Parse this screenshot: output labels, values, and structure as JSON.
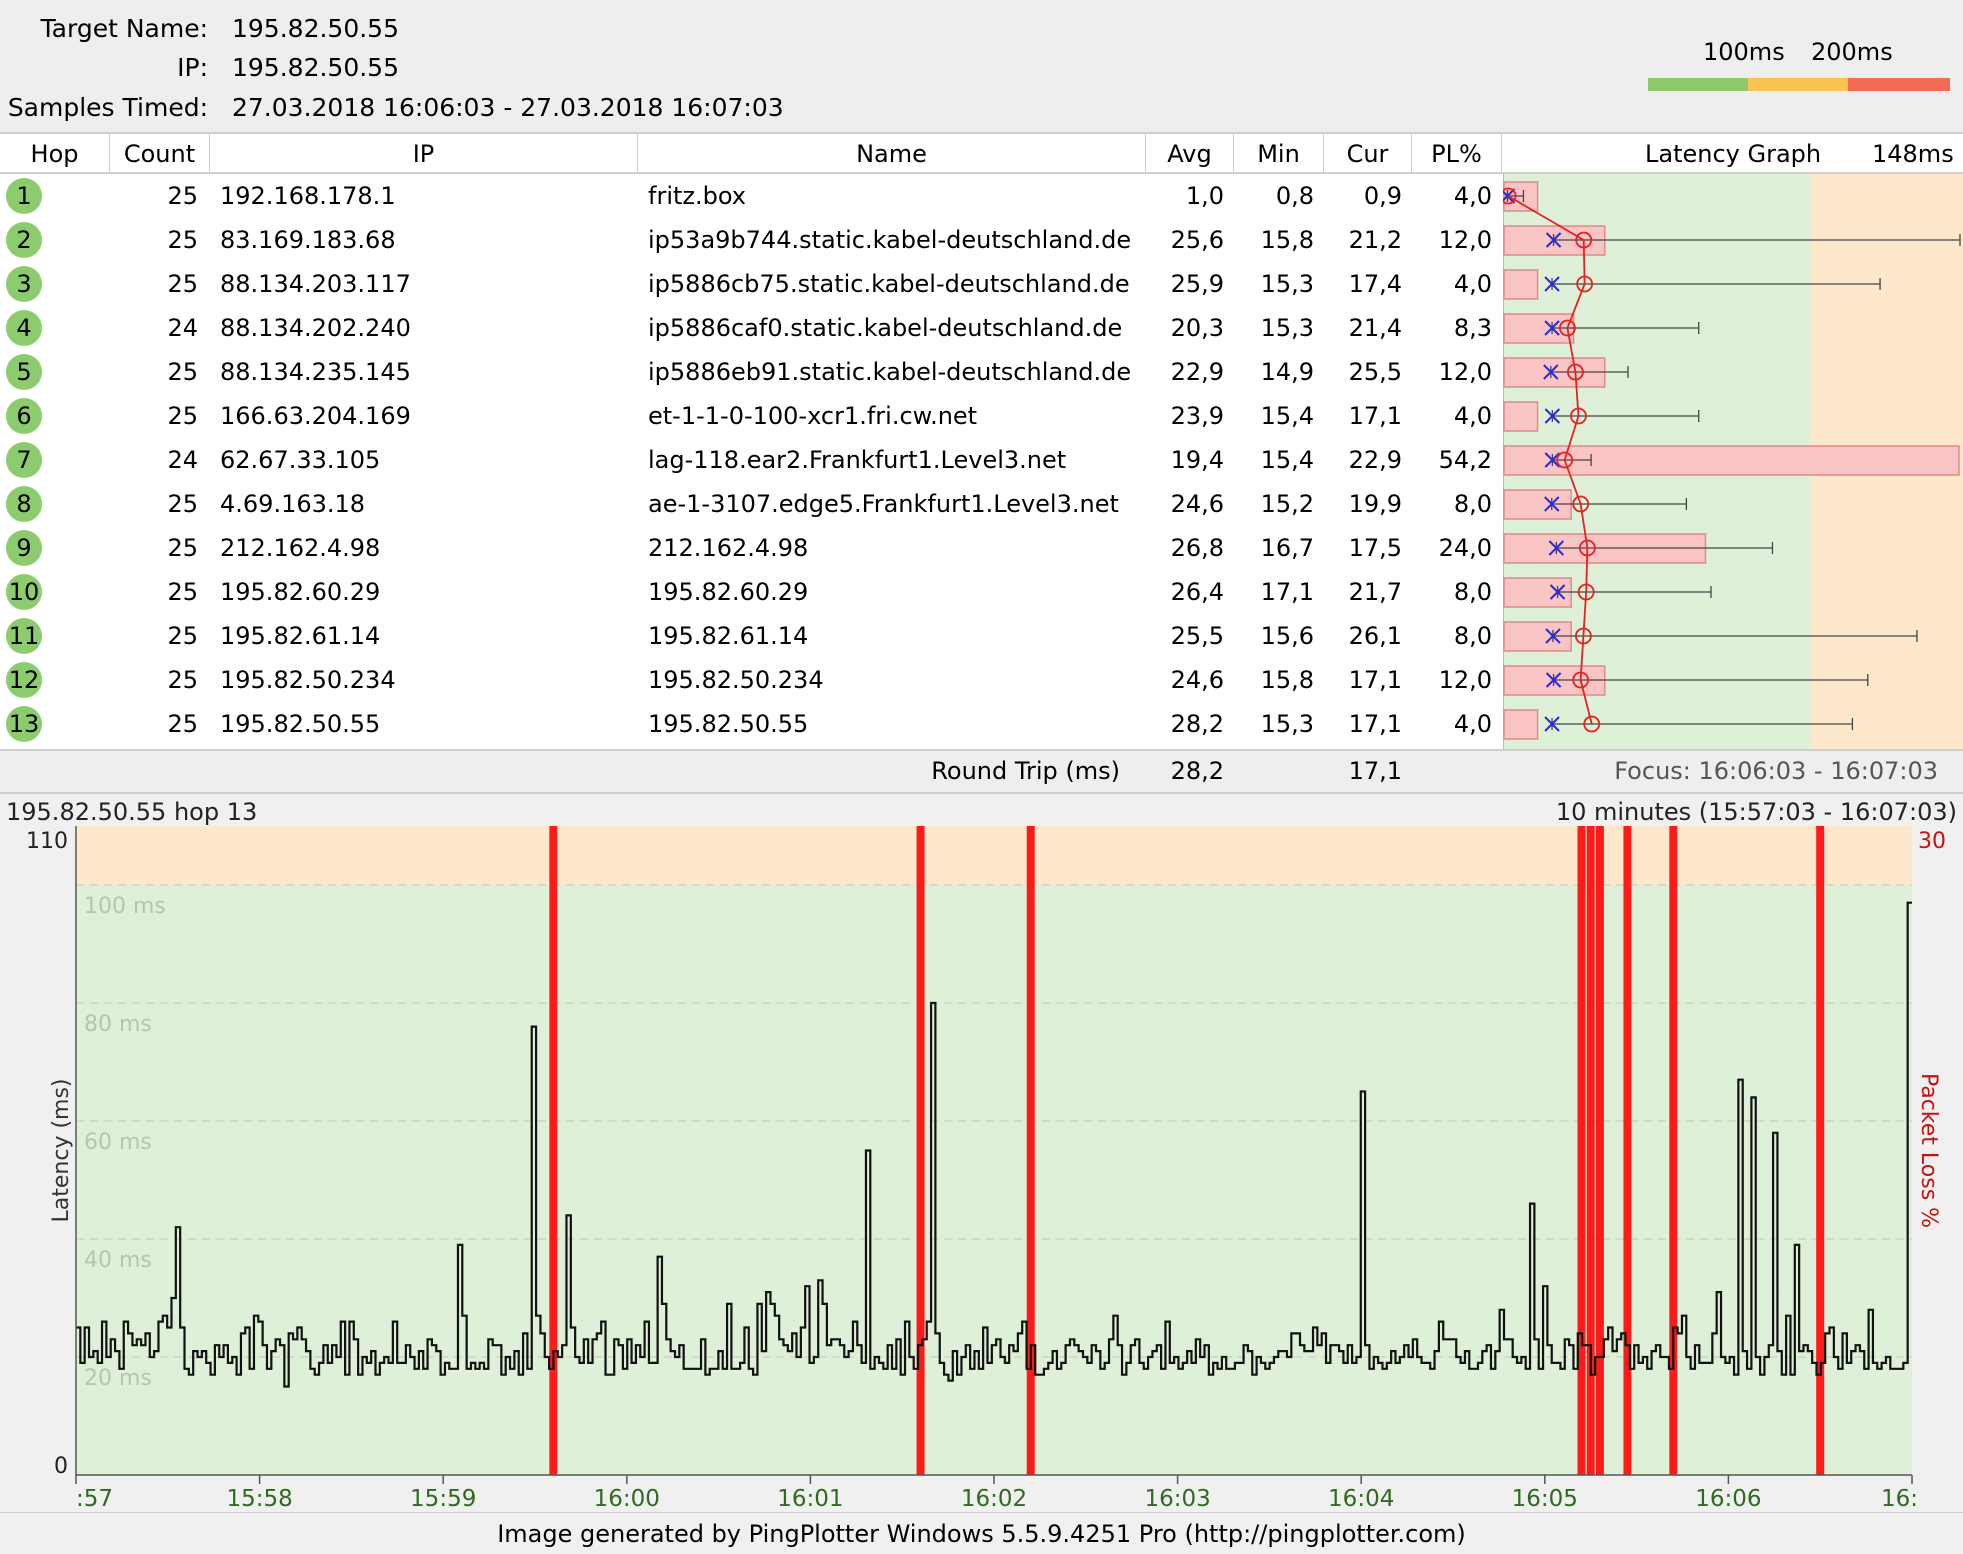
{
  "header": {
    "target_label": "Target Name:",
    "target_value": "195.82.50.55",
    "ip_label": "IP:",
    "ip_value": "195.82.50.55",
    "samples_label": "Samples Timed:",
    "samples_value": "27.03.2018 16:06:03 - 27.03.2018 16:07:03",
    "legend_100": "100ms",
    "legend_200": "200ms",
    "legend_colors": {
      "good": "#8fc96d",
      "warn": "#f9c252",
      "bad": "#f36a55"
    }
  },
  "table": {
    "columns": {
      "hop": "Hop",
      "count": "Count",
      "ip": "IP",
      "name": "Name",
      "avg": "Avg",
      "min": "Min",
      "cur": "Cur",
      "pl": "PL%",
      "latency_graph": "Latency Graph",
      "scale": "148ms"
    },
    "rows": [
      {
        "hop": "1",
        "count": "25",
        "ip": "192.168.178.1",
        "name": "fritz.box",
        "avg": "1,0",
        "min": "0,8",
        "cur": "0,9",
        "pl": "4,0"
      },
      {
        "hop": "2",
        "count": "25",
        "ip": "83.169.183.68",
        "name": "ip53a9b744.static.kabel-deutschland.de",
        "avg": "25,6",
        "min": "15,8",
        "cur": "21,2",
        "pl": "12,0"
      },
      {
        "hop": "3",
        "count": "25",
        "ip": "88.134.203.117",
        "name": "ip5886cb75.static.kabel-deutschland.de",
        "avg": "25,9",
        "min": "15,3",
        "cur": "17,4",
        "pl": "4,0"
      },
      {
        "hop": "4",
        "count": "24",
        "ip": "88.134.202.240",
        "name": "ip5886caf0.static.kabel-deutschland.de",
        "avg": "20,3",
        "min": "15,3",
        "cur": "21,4",
        "pl": "8,3"
      },
      {
        "hop": "5",
        "count": "25",
        "ip": "88.134.235.145",
        "name": "ip5886eb91.static.kabel-deutschland.de",
        "avg": "22,9",
        "min": "14,9",
        "cur": "25,5",
        "pl": "12,0"
      },
      {
        "hop": "6",
        "count": "25",
        "ip": "166.63.204.169",
        "name": "et-1-1-0-100-xcr1.fri.cw.net",
        "avg": "23,9",
        "min": "15,4",
        "cur": "17,1",
        "pl": "4,0"
      },
      {
        "hop": "7",
        "count": "24",
        "ip": "62.67.33.105",
        "name": "lag-118.ear2.Frankfurt1.Level3.net",
        "avg": "19,4",
        "min": "15,4",
        "cur": "22,9",
        "pl": "54,2"
      },
      {
        "hop": "8",
        "count": "25",
        "ip": "4.69.163.18",
        "name": "ae-1-3107.edge5.Frankfurt1.Level3.net",
        "avg": "24,6",
        "min": "15,2",
        "cur": "19,9",
        "pl": "8,0"
      },
      {
        "hop": "9",
        "count": "25",
        "ip": "212.162.4.98",
        "name": "212.162.4.98",
        "avg": "26,8",
        "min": "16,7",
        "cur": "17,5",
        "pl": "24,0"
      },
      {
        "hop": "10",
        "count": "25",
        "ip": "195.82.60.29",
        "name": "195.82.60.29",
        "avg": "26,4",
        "min": "17,1",
        "cur": "21,7",
        "pl": "8,0"
      },
      {
        "hop": "11",
        "count": "25",
        "ip": "195.82.61.14",
        "name": "195.82.61.14",
        "avg": "25,5",
        "min": "15,6",
        "cur": "26,1",
        "pl": "8,0"
      },
      {
        "hop": "12",
        "count": "25",
        "ip": "195.82.50.234",
        "name": "195.82.50.234",
        "avg": "24,6",
        "min": "15,8",
        "cur": "17,1",
        "pl": "12,0"
      },
      {
        "hop": "13",
        "count": "25",
        "ip": "195.82.50.55",
        "name": "195.82.50.55",
        "avg": "28,2",
        "min": "15,3",
        "cur": "17,1",
        "pl": "4,0"
      }
    ],
    "max_values": [
      6,
      148,
      122,
      63,
      40,
      63,
      28,
      59,
      87,
      67,
      134,
      118,
      113
    ]
  },
  "summary": {
    "label": "Round Trip (ms)",
    "avg": "28,2",
    "cur": "17,1",
    "focus": "Focus: 16:06:03 - 16:07:03"
  },
  "lower": {
    "title": "195.82.50.55 hop 13",
    "range": "10 minutes (15:57:03 - 16:07:03)",
    "footer": "Image generated by PingPlotter Windows 5.5.9.4251 Pro (http://pingplotter.com)"
  },
  "chart_data": {
    "type": "line",
    "title": "195.82.50.55 hop 13",
    "ylabel": "Latency (ms)",
    "y2label": "Packet Loss %",
    "ylim": [
      0,
      110
    ],
    "y2max": "30",
    "y_ticks": [
      "20 ms",
      "40 ms",
      "60 ms",
      "80 ms",
      "100 ms"
    ],
    "y_tick_values": [
      20,
      40,
      60,
      80,
      100
    ],
    "y_axis_end_labels": [
      "0",
      "110"
    ],
    "x_ticks": [
      ":57",
      "15:58",
      "15:59",
      "16:00",
      "16:01",
      "16:02",
      "16:03",
      "16:04",
      "16:05",
      "16:06",
      "16:"
    ],
    "x_tick_minutes": [
      0,
      1,
      2,
      3,
      4,
      5,
      6,
      7,
      8,
      9,
      10
    ],
    "packet_loss_minutes": [
      2.6,
      4.6,
      5.2,
      8.2,
      8.25,
      8.3,
      8.45,
      8.7,
      9.5
    ],
    "latency_series": {
      "name": "",
      "sample_interval_minutes": 0.0167,
      "values": [
        25,
        19,
        25,
        20,
        21,
        19,
        26,
        20,
        23,
        21,
        18,
        26,
        24,
        22,
        23,
        22,
        24,
        20,
        21,
        26,
        27,
        25,
        30,
        42,
        25,
        18,
        17,
        21,
        20,
        21,
        19,
        17,
        22,
        20,
        22,
        19,
        20,
        17,
        24,
        25,
        18,
        27,
        26,
        22,
        18,
        21,
        23,
        22,
        15,
        24,
        23,
        25,
        23,
        21,
        18,
        17,
        19,
        22,
        19,
        22,
        20,
        26,
        17,
        26,
        23,
        17,
        20,
        19,
        21,
        17,
        19,
        20,
        19,
        26,
        19,
        19,
        22,
        20,
        18,
        21,
        18,
        23,
        22,
        21,
        17,
        19,
        18,
        18,
        39,
        27,
        18,
        19,
        18,
        19,
        18,
        23,
        22,
        22,
        17,
        20,
        18,
        21,
        17,
        24,
        18,
        76,
        27,
        24,
        20,
        18,
        21,
        20,
        22,
        44,
        25,
        20,
        19,
        23,
        19,
        23,
        24,
        26,
        17,
        17,
        23,
        22,
        18,
        23,
        19,
        22,
        20,
        26,
        19,
        19,
        37,
        29,
        23,
        21,
        20,
        22,
        18,
        18,
        18,
        18,
        23,
        17,
        18,
        18,
        21,
        18,
        29,
        18,
        18,
        19,
        25,
        18,
        17,
        29,
        21,
        31,
        29,
        27,
        23,
        22,
        21,
        24,
        20,
        25,
        32,
        19,
        20,
        33,
        29,
        22,
        23,
        23,
        22,
        20,
        21,
        26,
        22,
        19,
        55,
        18,
        20,
        19,
        18,
        22,
        18,
        23,
        17,
        26,
        20,
        18,
        22,
        23,
        26,
        80,
        24,
        19,
        17,
        16,
        21,
        17,
        20,
        22,
        18,
        21,
        18,
        25,
        19,
        22,
        23,
        20,
        19,
        22,
        21,
        24,
        26,
        18,
        22,
        17,
        17,
        18,
        19,
        21,
        18,
        19,
        22,
        23,
        22,
        21,
        20,
        19,
        22,
        21,
        18,
        19,
        23,
        27,
        22,
        17,
        19,
        22,
        23,
        19,
        18,
        20,
        21,
        22,
        18,
        26,
        19,
        20,
        18,
        19,
        21,
        19,
        23,
        20,
        22,
        17,
        19,
        18,
        20,
        18,
        18,
        19,
        19,
        22,
        21,
        17,
        20,
        19,
        18,
        19,
        20,
        21,
        21,
        20,
        24,
        24,
        22,
        21,
        21,
        25,
        22,
        24,
        19,
        22,
        22,
        21,
        19,
        22,
        19,
        20,
        65,
        22,
        18,
        20,
        19,
        18,
        19,
        21,
        19,
        20,
        22,
        20,
        23,
        20,
        19,
        19,
        18,
        21,
        26,
        23,
        23,
        23,
        20,
        19,
        21,
        18,
        18,
        19,
        21,
        22,
        18,
        21,
        28,
        23,
        23,
        20,
        19,
        20,
        18,
        46,
        23,
        18,
        32,
        22,
        19,
        19,
        18,
        23,
        22,
        18,
        24,
        22,
        22,
        17,
        20,
        20,
        23,
        25,
        21,
        23,
        24,
        22,
        18,
        22,
        19,
        20,
        18,
        21,
        22,
        20,
        20,
        18,
        25,
        24,
        27,
        20,
        18,
        22,
        19,
        19,
        19,
        24,
        31,
        20,
        19,
        20,
        17,
        67,
        21,
        18,
        64,
        20,
        17,
        20,
        22,
        58,
        21,
        17,
        27,
        17,
        39,
        21,
        22,
        21,
        19,
        17,
        19,
        24,
        25,
        20,
        18,
        24,
        19,
        21,
        22,
        21,
        18,
        28,
        19,
        18,
        19,
        20,
        18,
        18,
        18,
        19,
        97
      ]
    }
  },
  "colors": {
    "green_zone": "#dff0d8",
    "orange_zone": "#fde8cc",
    "loss": "#ff1a1a",
    "line": "#111111",
    "graph_bar": "#f9c4c4",
    "graph_bar_border": "#e08a8a",
    "min_marker": "#2a2ad8",
    "avg_marker": "#e82020",
    "hop_badge": "#8dcc6e",
    "x_tick_text": "#2e6b1e",
    "right_axis_text": "#c81010"
  }
}
